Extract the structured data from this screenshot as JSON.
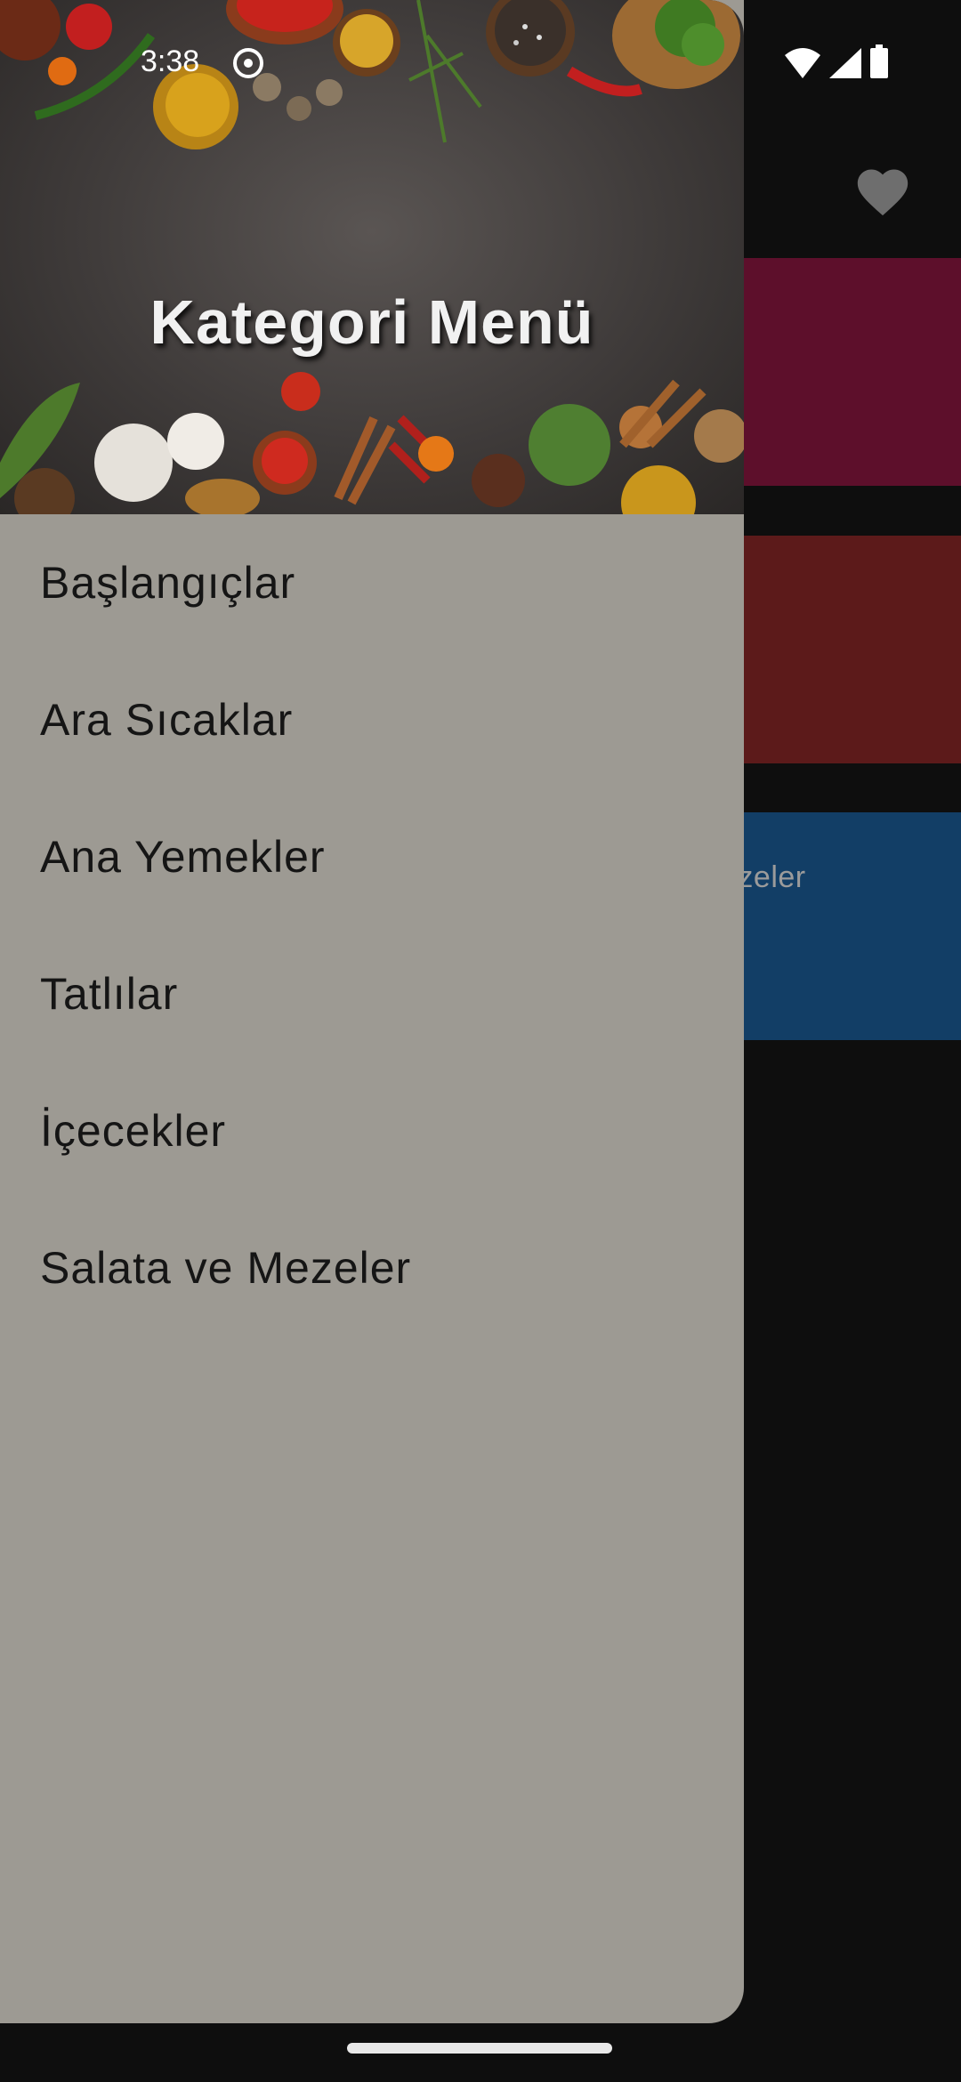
{
  "status_bar": {
    "time": "3:38",
    "icons": [
      "record-icon",
      "wifi-icon",
      "signal-icon",
      "battery-icon"
    ]
  },
  "drawer": {
    "header_title": "Kategori Menü",
    "items": [
      {
        "label": "Başlangıçlar"
      },
      {
        "label": "Ara Sıcaklar"
      },
      {
        "label": "Ana Yemekler"
      },
      {
        "label": "Tatlılar"
      },
      {
        "label": "İçecekler"
      },
      {
        "label": "Salata ve Mezeler"
      }
    ]
  },
  "background": {
    "favorite_icon": "heart-icon",
    "cards": [
      {
        "label": "",
        "color": "#5d0f2b"
      },
      {
        "label": "",
        "color": "#5c1a1a"
      },
      {
        "label": "ezeler",
        "color": "#123e66"
      }
    ]
  },
  "colors": {
    "drawer_bg": "#9d9a93",
    "scrim_bg": "#0e0e0e",
    "text": "#151515"
  }
}
